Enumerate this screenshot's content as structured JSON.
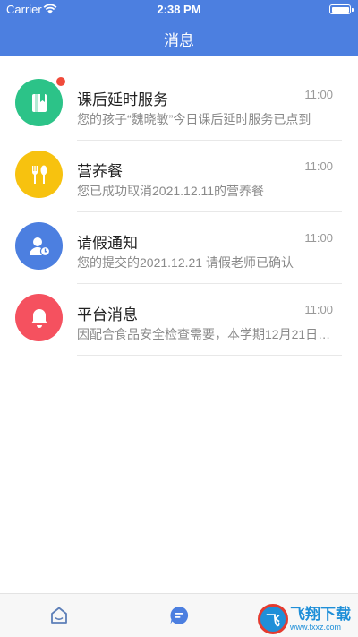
{
  "status_bar": {
    "carrier": "Carrier",
    "time": "2:38 PM"
  },
  "header": {
    "title": "消息"
  },
  "messages": [
    {
      "name": "课后延时服务",
      "time": "11:00",
      "preview": "您的孩子“魏晓敏”今日课后延时服务已点到",
      "icon": "book-icon",
      "color": "#2cc388",
      "unread": true
    },
    {
      "name": "营养餐",
      "time": "11:00",
      "preview": "您已成功取消2021.12.11的营养餐",
      "icon": "fork-spoon-icon",
      "color": "#f7c20f",
      "unread": false
    },
    {
      "name": "请假通知",
      "time": "11:00",
      "preview": "您的提交的2021.12.21 请假老师已确认",
      "icon": "person-clock-icon",
      "color": "#4c7fe0",
      "unread": false
    },
    {
      "name": "平台消息",
      "time": "11:00",
      "preview": "因配合食品安全检查需要，本学期12月21日…",
      "icon": "bell-icon",
      "color": "#f5515f",
      "unread": false
    }
  ],
  "tabbar": {
    "items": [
      {
        "icon": "home-icon"
      },
      {
        "icon": "message-icon",
        "active": true
      }
    ]
  },
  "watermark": {
    "logo": "飞",
    "title": "飞翔下载",
    "url": "www.fxxz.com"
  }
}
